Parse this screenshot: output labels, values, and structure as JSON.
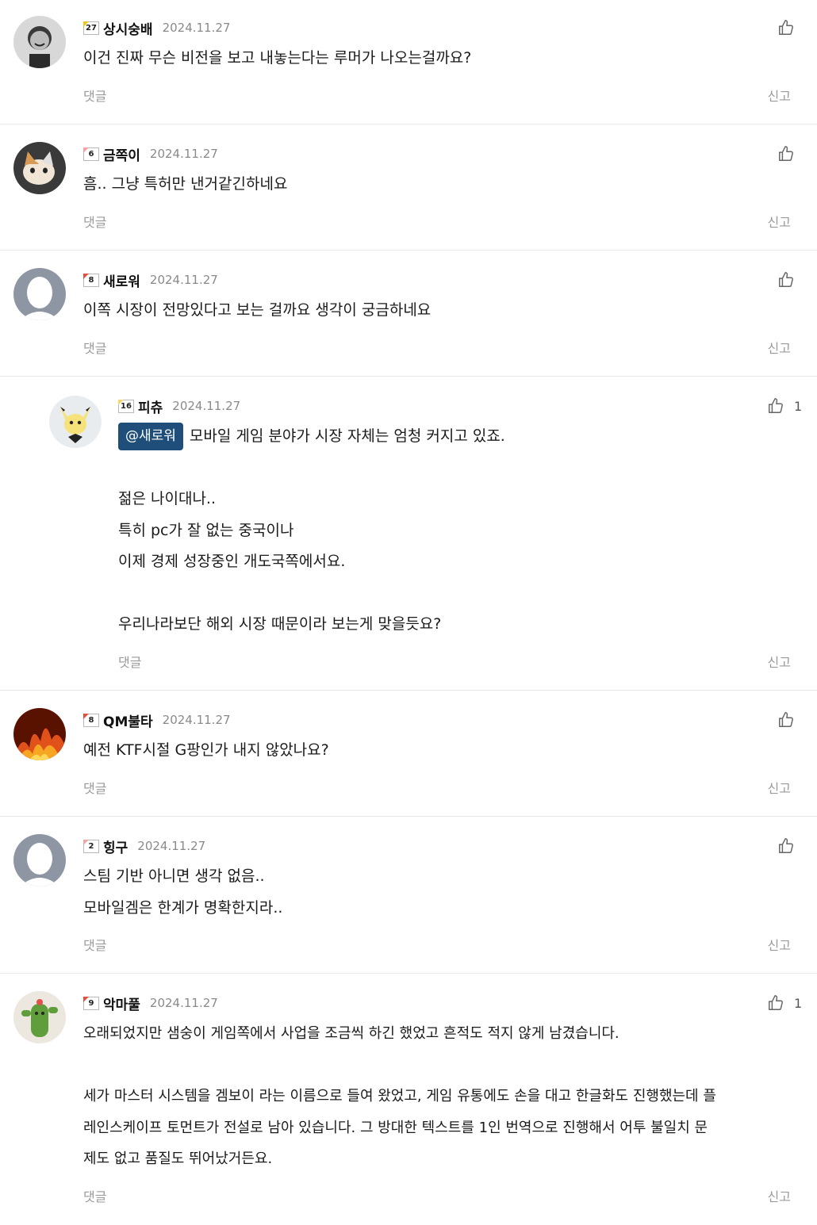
{
  "labels": {
    "reply": "댓글",
    "report": "신고"
  },
  "comments": [
    {
      "level": "27",
      "level_color": "#f0c419",
      "nick": "상시숭배",
      "date": "2024.11.27",
      "lines": [
        "이건 진짜 무슨 비전을 보고 내놓는다는 루머가 나오는걸까요?"
      ],
      "likes": ""
    },
    {
      "level": "6",
      "level_color": "#f7a1a1",
      "nick": "금쪽이",
      "date": "2024.11.27",
      "lines": [
        "흠.. 그냥 특허만 낸거같긴하네요"
      ],
      "likes": ""
    },
    {
      "level": "8",
      "level_color": "#e74c3c",
      "nick": "새로워",
      "date": "2024.11.27",
      "lines": [
        "이쪽 시장이 전망있다고 보는 걸까요 생각이 궁금하네요"
      ],
      "likes": ""
    },
    {
      "level": "16",
      "level_color": "#f5d76e",
      "nick": "피츄",
      "date": "2024.11.27",
      "mention": "@새로워",
      "lines": [
        "모바일 게임 분야가 시장 자체는 엄청 커지고 있죠.",
        "",
        "젊은 나이대나..",
        "특히 pc가 잘 없는 중국이나",
        "이제 경제 성장중인 개도국쪽에서요.",
        "",
        "우리나라보단 해외 시장 때문이라 보는게 맞을듯요?"
      ],
      "likes": "1"
    },
    {
      "level": "8",
      "level_color": "#e74c3c",
      "nick": "QM불타",
      "date": "2024.11.27",
      "lines": [
        "예전 KTF시절 G팡인가 내지 않았나요?"
      ],
      "likes": ""
    },
    {
      "level": "2",
      "level_color": "#f2a3a3",
      "nick": "힝구",
      "date": "2024.11.27",
      "lines": [
        "스팀 기반 아니면 생각 없음..",
        "모바일겜은 한계가 명확한지라.."
      ],
      "likes": ""
    },
    {
      "level": "9",
      "level_color": "#e74c3c",
      "nick": "악마풀",
      "date": "2024.11.27",
      "lines": [
        "오래되었지만 샘숭이 게임쪽에서 사업을 조금씩 하긴 했었고 흔적도 적지 않게 남겼습니다.",
        "",
        "세가 마스터 시스템을 겜보이 라는 이름으로 들여 왔었고, 게임 유통에도 손을 대고 한글화도 진행했는데 플",
        "레인스케이프 토먼트가 전설로 남아 있습니다. 그 방대한 텍스트를 1인 번역으로 진행해서 어투 불일치 문",
        "제도 없고 품질도 뛰어났거든요."
      ],
      "likes": "1"
    }
  ]
}
